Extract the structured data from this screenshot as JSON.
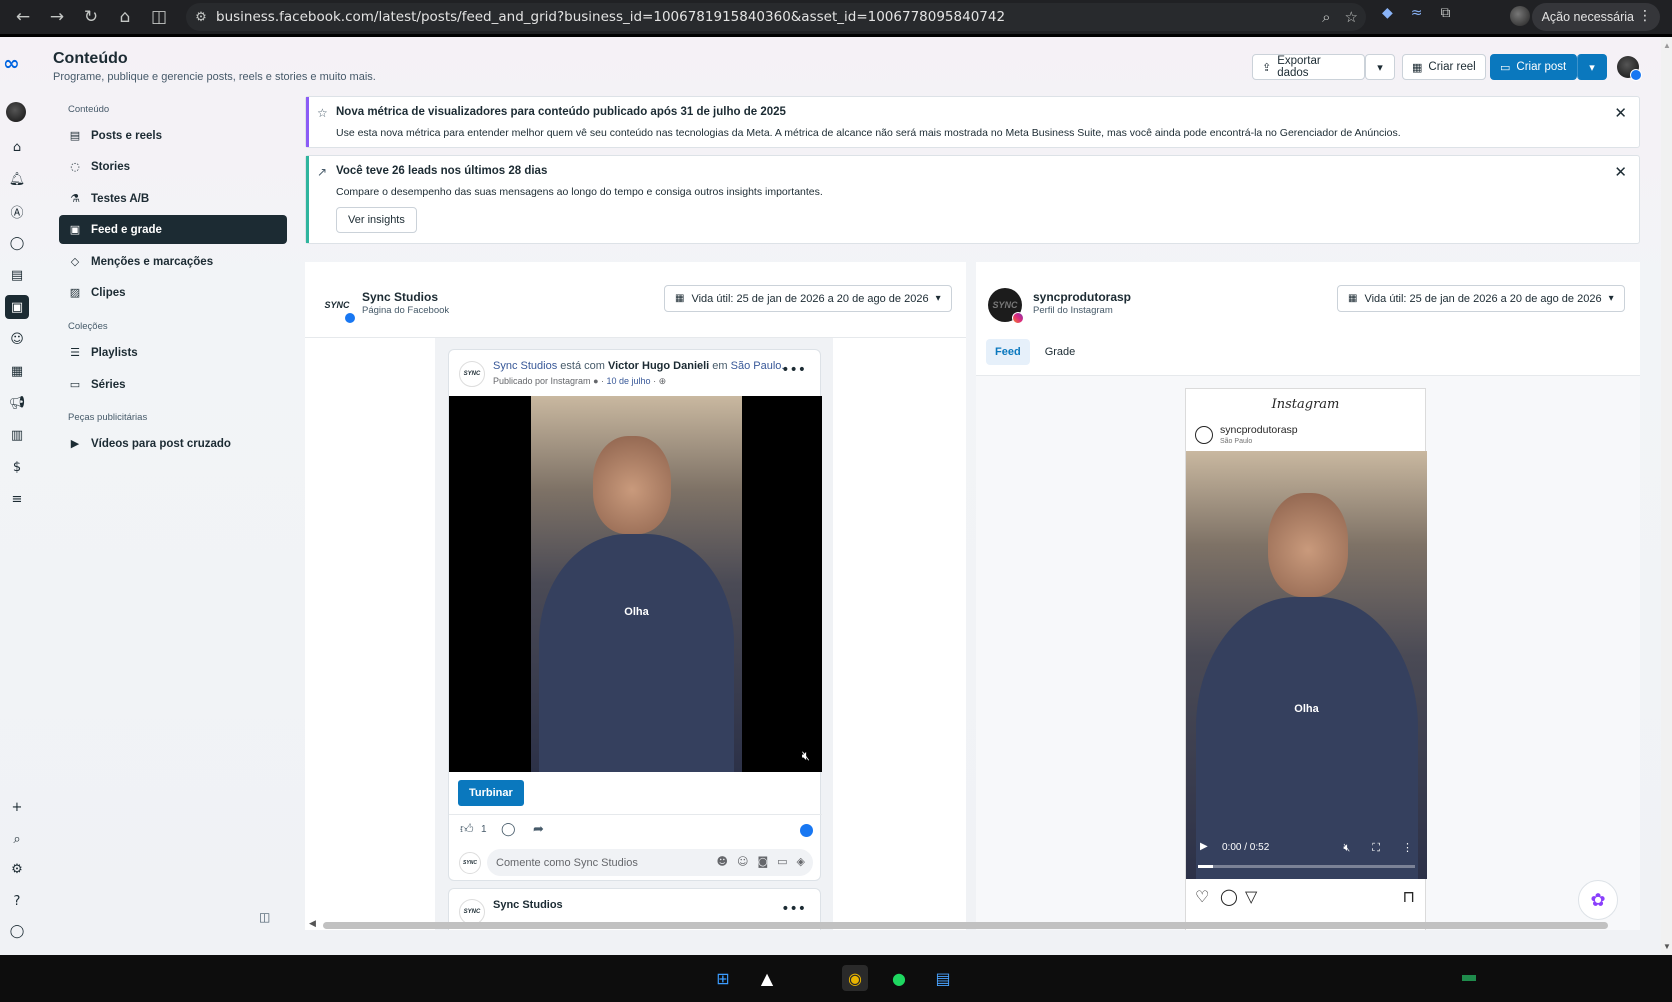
{
  "browser": {
    "url": "business.facebook.com/latest/posts/feed_and_grid?business_id=1006781915840360&asset_id=1006778095840742",
    "action_label": "Ação necessária"
  },
  "header": {
    "title": "Conteúdo",
    "subtitle": "Programe, publique e gerencie posts, reels e stories e muito mais.",
    "export_label": "Exportar dados",
    "create_reel_label": "Criar reel",
    "create_post_label": "Criar post"
  },
  "sidebar": {
    "section1": "Conteúdo",
    "items": [
      {
        "label": "Posts e reels",
        "icon": "posts-icon"
      },
      {
        "label": "Stories",
        "icon": "stories-icon"
      },
      {
        "label": "Testes A/B",
        "icon": "flask-icon"
      },
      {
        "label": "Feed e grade",
        "icon": "feed-grid-icon",
        "active": true
      },
      {
        "label": "Menções e marcações",
        "icon": "tag-icon"
      },
      {
        "label": "Clipes",
        "icon": "clips-icon"
      }
    ],
    "section2": "Coleções",
    "collections": [
      {
        "label": "Playlists",
        "icon": "playlist-icon"
      },
      {
        "label": "Séries",
        "icon": "series-icon"
      }
    ],
    "section3": "Peças publicitárias",
    "ads": [
      {
        "label": "Vídeos para post cruzado",
        "icon": "video-icon"
      }
    ]
  },
  "banners": [
    {
      "title": "Nova métrica de visualizadores para conteúdo publicado após 31 de julho de 2025",
      "text": "Use esta nova métrica para entender melhor quem vê seu conteúdo nas tecnologias da Meta. A métrica de alcance não será mais mostrada no Meta Business Suite, mas você ainda pode encontrá-la no Gerenciador de Anúncios.",
      "accent": "#8b5cf6"
    },
    {
      "title": "Você teve 26 leads nos últimos 28 dias",
      "text": "Compare o desempenho das suas mensagens ao longo do tempo e consiga outros insights importantes.",
      "button": "Ver insights",
      "accent": "#2fb59e"
    }
  ],
  "fb_panel": {
    "name": "Sync Studios",
    "type": "Página do Facebook",
    "logo_text": "SYNC",
    "date_range": "Vida útil: 25 de jan de 2026 a 20 de ago de 2026",
    "post": {
      "author": "Sync Studios",
      "with_text": "está com",
      "tagged": "Victor Hugo Danieli",
      "in_text": "em",
      "place": "São Paulo.",
      "published_by": "Publicado por Instagram",
      "date": "10 de julho",
      "caption": "Olha",
      "boost_label": "Turbinar",
      "like_count": "1",
      "comment_placeholder": "Comente como Sync Studios"
    },
    "post2_author": "Sync Studios"
  },
  "ig_panel": {
    "name": "syncprodutorasp",
    "type": "Perfil do Instagram",
    "date_range": "Vida útil: 25 de jan de 2026 a 20 de ago de 2026",
    "tabs": [
      "Feed",
      "Grade"
    ],
    "brand": "Instagram",
    "user": "syncprodutorasp",
    "location": "São Paulo",
    "caption": "Olha",
    "time": "0:00 / 0:52",
    "progress": 0.07
  }
}
